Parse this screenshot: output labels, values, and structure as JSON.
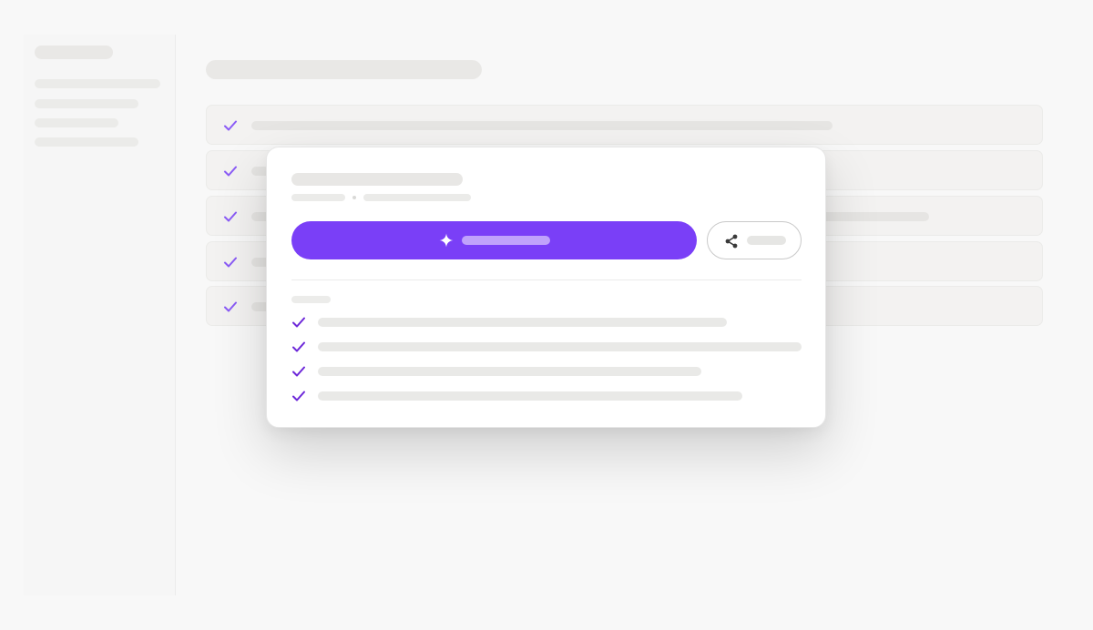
{
  "colors": {
    "accent": "#7a3ff7",
    "accent_muted": "#c0a2fb",
    "placeholder": "#ebebe9",
    "check_background": "#8b5cf6",
    "check_modal": "#6d28d9"
  },
  "icons": {
    "check": "check-icon",
    "sparkle": "sparkle-icon",
    "share": "share-icon"
  },
  "sidebar": {
    "items": 4
  },
  "list": {
    "rows": 5
  },
  "modal": {
    "features": 4
  }
}
